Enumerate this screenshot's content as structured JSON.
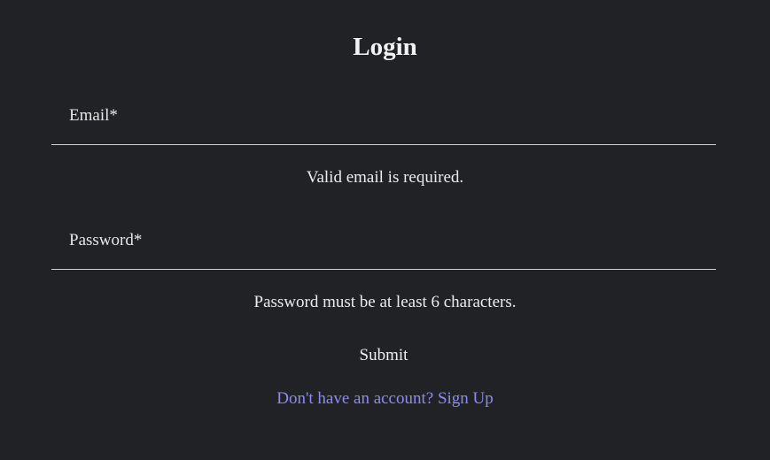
{
  "title": "Login",
  "form": {
    "email": {
      "label": "Email*",
      "value": "",
      "error": "Valid email is required."
    },
    "password": {
      "label": "Password*",
      "value": "",
      "error": "Password must be at least 6 characters."
    },
    "submit_label": "Submit",
    "signup_link": "Don't have an account? Sign Up"
  },
  "colors": {
    "background": "#202226",
    "text": "#e8e8e8",
    "link": "#8c8cf0",
    "underline": "#cfcfcf"
  }
}
